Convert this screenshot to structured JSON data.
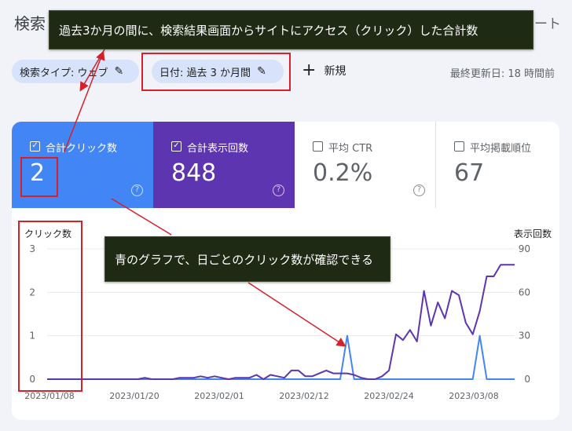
{
  "header": {
    "title": "検索",
    "right_text": "ート"
  },
  "filters": {
    "search_type": "検索タイプ: ウェブ",
    "date": "日付: 過去 3 か月間",
    "add_new": "新規",
    "last_updated": "最終更新日: 18 時間前"
  },
  "metrics": [
    {
      "label": "合計クリック数",
      "value": "2",
      "checked": true,
      "color": "#4285f4"
    },
    {
      "label": "合計表示回数",
      "value": "848",
      "checked": true,
      "color": "#5e35b1"
    },
    {
      "label": "平均 CTR",
      "value": "0.2%",
      "checked": false
    },
    {
      "label": "平均掲載順位",
      "value": "67",
      "checked": false
    }
  ],
  "annotations": {
    "callout_top": "過去3か月の間に、検索結果画面からサイトにアクセス（クリック）した合計数",
    "callout_chart": "青のグラフで、日ごとのクリック数が確認できる"
  },
  "chart_data": {
    "type": "line",
    "left_axis_label": "クリック数",
    "right_axis_label": "表示回数",
    "left_ticks": [
      "0",
      "1",
      "2",
      "3"
    ],
    "right_ticks": [
      "0",
      "30",
      "60",
      "90"
    ],
    "x_tick_labels": [
      "2023/01/08",
      "2023/01/20",
      "2023/02/01",
      "2023/02/12",
      "2023/02/24",
      "2023/03/08"
    ],
    "ylim_left": [
      0,
      3
    ],
    "ylim_right": [
      0,
      90
    ],
    "series": [
      {
        "name": "クリック数",
        "axis": "left",
        "color": "#4285f4",
        "values": [
          0,
          0,
          0,
          0,
          0,
          0,
          0,
          0,
          0,
          0,
          0,
          0,
          0,
          0,
          0,
          0,
          0,
          0,
          0,
          0,
          0,
          0,
          0,
          0,
          0,
          0,
          0,
          0,
          0,
          0,
          0,
          0,
          0,
          0,
          0,
          0,
          0,
          0,
          0,
          0,
          0,
          0,
          0,
          1,
          0,
          0,
          0,
          0,
          0,
          0,
          0,
          0,
          0,
          0,
          0,
          0,
          0,
          0,
          0,
          0,
          0,
          0,
          1,
          0,
          0,
          0,
          0,
          0
        ]
      },
      {
        "name": "表示回数",
        "axis": "right",
        "color": "#5e35b1",
        "values": [
          0,
          0,
          0,
          0,
          0,
          0,
          0,
          0,
          0,
          0,
          0,
          0,
          0,
          0,
          1,
          0,
          0,
          0,
          0,
          1,
          1,
          1,
          2,
          1,
          2,
          1,
          0,
          1,
          1,
          1,
          3,
          0,
          3,
          2,
          1,
          6,
          6,
          2,
          2,
          4,
          6,
          4,
          4,
          4,
          3,
          1,
          0,
          0,
          2,
          6,
          31,
          27,
          34,
          26,
          61,
          37,
          53,
          42,
          61,
          58,
          39,
          31,
          47,
          71,
          71,
          79,
          79,
          79
        ]
      }
    ]
  }
}
